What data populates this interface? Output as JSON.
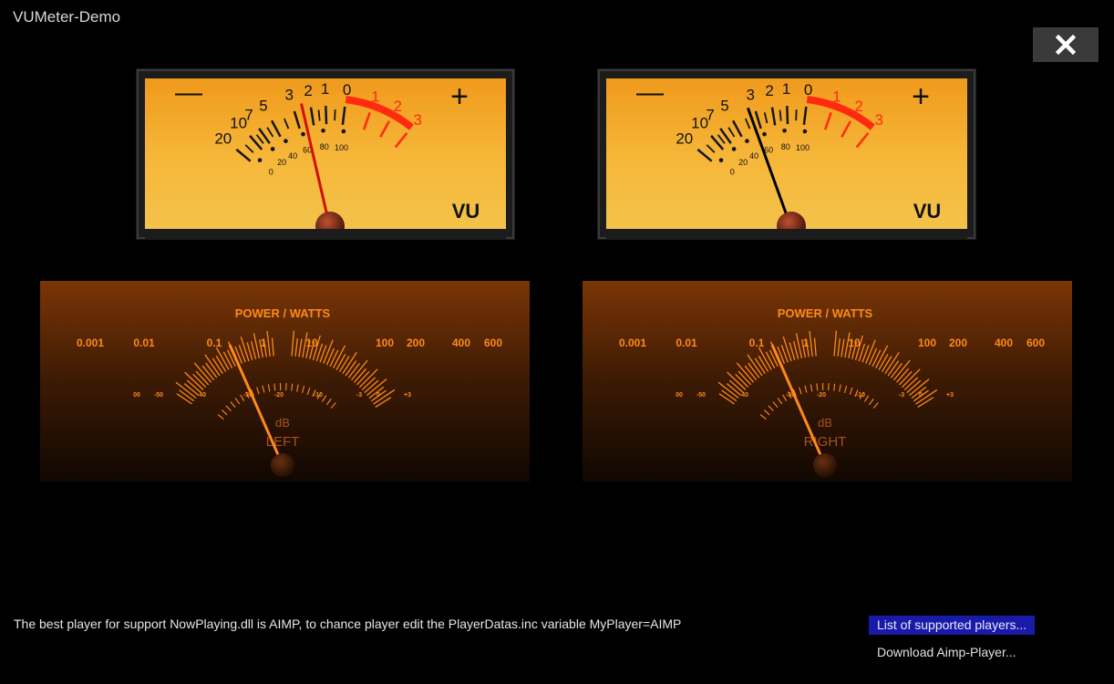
{
  "window": {
    "title": "VUMeter-Demo",
    "close_icon": "close-icon"
  },
  "vu_meters": [
    {
      "side": "left",
      "unit_label": "VU",
      "minus_label": "—",
      "plus_label": "+",
      "needle_color": "#d01000",
      "needle_level": -2.5,
      "db_labels": [
        "20",
        "10",
        "7",
        "5",
        "3",
        "2",
        "1",
        "0",
        "1",
        "2",
        "3"
      ],
      "percent_labels": [
        "0",
        "20",
        "40",
        "60",
        "80",
        "100"
      ]
    },
    {
      "side": "right",
      "unit_label": "VU",
      "minus_label": "—",
      "plus_label": "+",
      "needle_color": "#000000",
      "needle_level": -3.5,
      "db_labels": [
        "20",
        "10",
        "7",
        "5",
        "3",
        "2",
        "1",
        "0",
        "1",
        "2",
        "3"
      ],
      "percent_labels": [
        "0",
        "20",
        "40",
        "60",
        "80",
        "100"
      ]
    }
  ],
  "power_meters": [
    {
      "side": "left",
      "title": "POWER / WATTS",
      "channel": "LEFT",
      "unit": "dB",
      "watt_labels": [
        "0.001",
        "0.01",
        "0.1",
        "1",
        "10",
        "100",
        "200",
        "400",
        "600"
      ],
      "db_labels": [
        "00",
        "-50",
        "-40",
        "-30",
        "-20",
        "-10",
        "-3",
        "0",
        "+3"
      ],
      "needle_level_watts": 0.1
    },
    {
      "side": "right",
      "title": "POWER / WATTS",
      "channel": "RIGHT",
      "unit": "dB",
      "watt_labels": [
        "0.001",
        "0.01",
        "0.1",
        "1",
        "10",
        "100",
        "200",
        "400",
        "600"
      ],
      "db_labels": [
        "00",
        "-50",
        "-40",
        "-30",
        "-20",
        "-10",
        "-3",
        "0",
        "+3"
      ],
      "needle_level_watts": 0.1
    }
  ],
  "footer": {
    "info": "The best player for support NowPlaying.dll is AIMP, to chance player edit the PlayerDatas.inc variable MyPlayer=AIMP",
    "list_link": "List of supported players...",
    "download_link": "Download Aimp-Player..."
  },
  "colors": {
    "vu_face_top": "#f0a020",
    "vu_face_bottom": "#f5c040",
    "red_zone": "#ff2a10",
    "power_orange": "#ff8a1a"
  }
}
